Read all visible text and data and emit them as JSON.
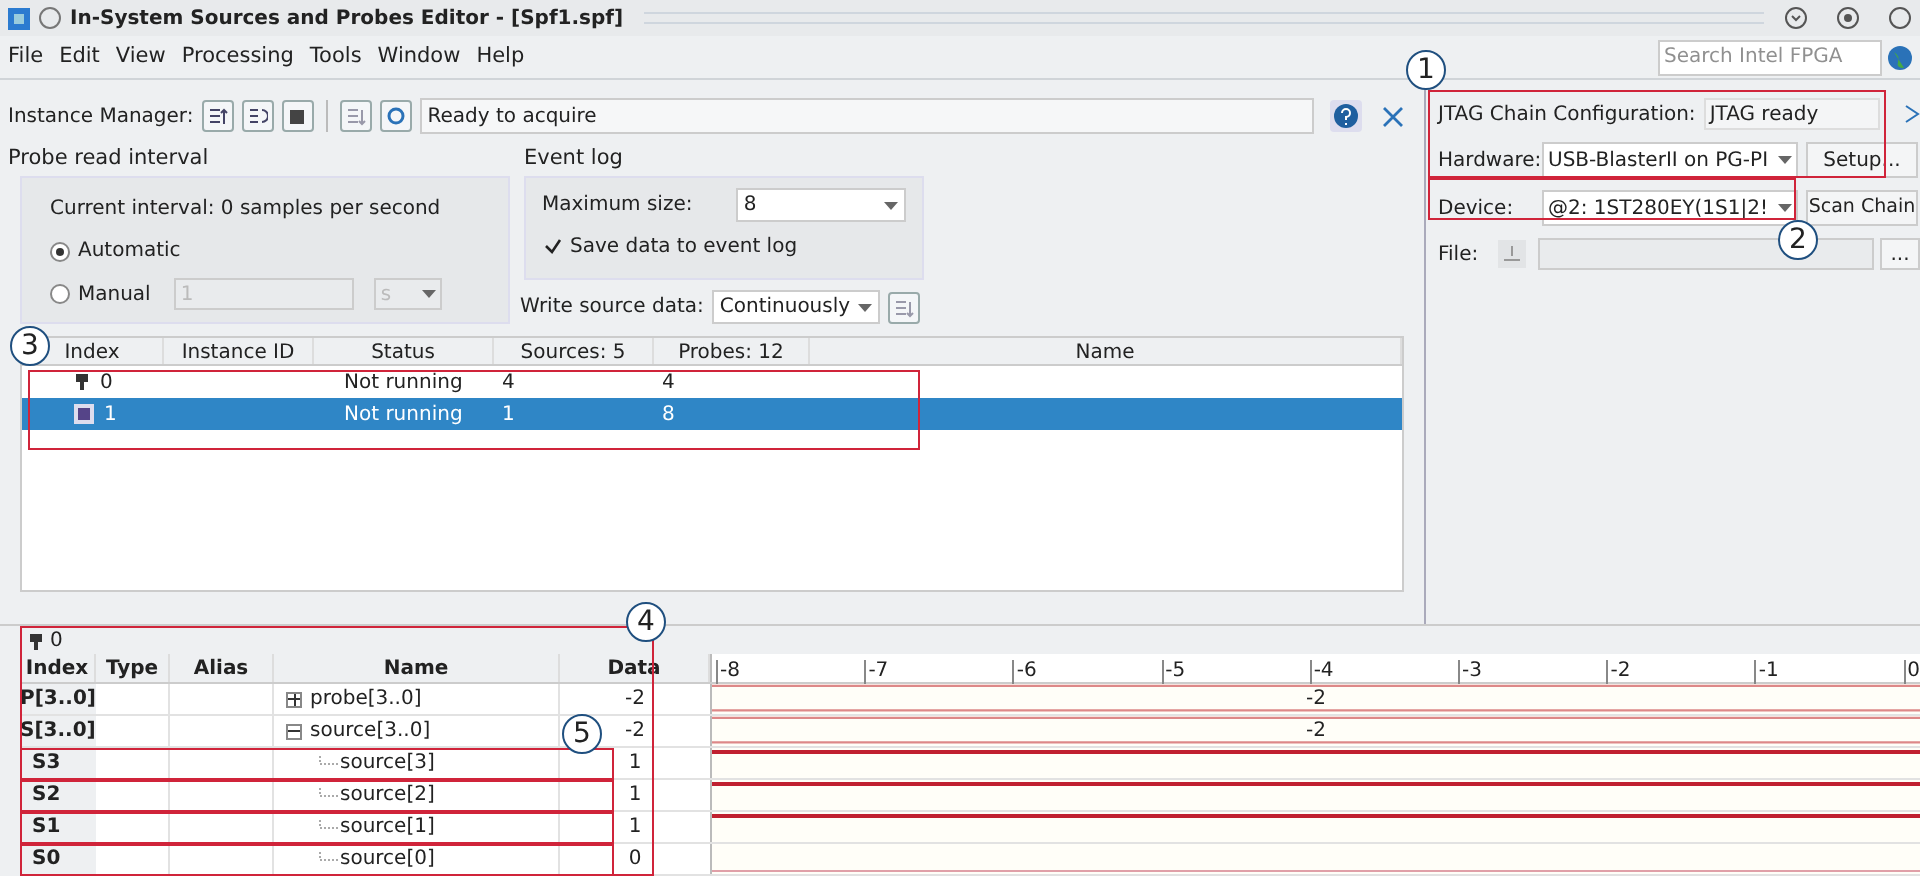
{
  "window": {
    "title": "In-System Sources and Probes Editor - [Spf1.spf]"
  },
  "menu": [
    "File",
    "Edit",
    "View",
    "Processing",
    "Tools",
    "Window",
    "Help"
  ],
  "search": {
    "placeholder": "Search Intel FPGA"
  },
  "instance_manager": {
    "label": "Instance Manager:",
    "status": "Ready to acquire"
  },
  "probe_read_interval": {
    "title": "Probe read interval",
    "current": "Current interval:  0 samples per second",
    "options": [
      {
        "label": "Automatic",
        "selected": true
      },
      {
        "label": "Manual",
        "selected": false,
        "value": "1",
        "unit": "s"
      }
    ]
  },
  "event_log": {
    "title": "Event log",
    "max_size_label": "Maximum size:",
    "max_size": "8",
    "save_label": "Save data to event log",
    "save_checked": true
  },
  "write_source": {
    "label": "Write source data:",
    "value": "Continuously"
  },
  "instances": {
    "columns": [
      "Index",
      "Instance ID",
      "Status",
      "Sources: 5",
      "Probes: 12",
      "Name"
    ],
    "rows": [
      {
        "index": "0",
        "status": "Not running",
        "sources": "4",
        "probes": "4",
        "selected": false
      },
      {
        "index": "1",
        "status": "Not running",
        "sources": "1",
        "probes": "8",
        "selected": true
      }
    ]
  },
  "jtag": {
    "title": "JTAG Chain Configuration:",
    "status": "JTAG ready",
    "hardware_label": "Hardware:",
    "hardware": "USB-BlasterII on PG-PI",
    "setup": "Setup...",
    "device_label": "Device:",
    "device": "@2: 1ST280EY(1S1|2!",
    "scan": "Scan Chain",
    "file_label": "File:",
    "browse": "..."
  },
  "signals": {
    "instance": "0",
    "columns": [
      "Index",
      "Type",
      "Alias",
      "Name",
      "Data"
    ],
    "ticks": [
      "-8",
      "-7",
      "-6",
      "-5",
      "-4",
      "-3",
      "-2",
      "-1",
      "0"
    ],
    "rows": [
      {
        "kind": "bus",
        "index": "P[3..0]",
        "name": "probe[3..0]",
        "expanded": false,
        "data": "-2",
        "wave_label": "-2"
      },
      {
        "kind": "bus",
        "index": "S[3..0]",
        "name": "source[3..0]",
        "expanded": true,
        "data": "-2",
        "wave_label": "-2",
        "children": [
          {
            "kind": "bit",
            "index": "S3",
            "name": "source[3]",
            "data": "1",
            "high": true
          },
          {
            "kind": "bit",
            "index": "S2",
            "name": "source[2]",
            "data": "1",
            "high": true
          },
          {
            "kind": "bit",
            "index": "S1",
            "name": "source[1]",
            "data": "1",
            "high": true
          },
          {
            "kind": "bit",
            "index": "S0",
            "name": "source[0]",
            "data": "0",
            "high": false
          }
        ]
      }
    ]
  },
  "callouts": [
    {
      "label": "1"
    },
    {
      "label": "2"
    },
    {
      "label": "3"
    },
    {
      "label": "4"
    },
    {
      "label": "5"
    }
  ]
}
